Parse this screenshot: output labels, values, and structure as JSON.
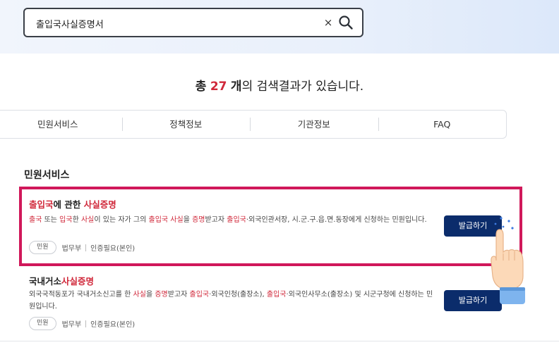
{
  "search": {
    "value": "출입국사실증명서",
    "clear_label": "×"
  },
  "summary": {
    "prefix": "총",
    "count": "27",
    "unit": "개",
    "suffix": "의 검색결과가 있습니다."
  },
  "tabs": [
    {
      "label": "민원서비스"
    },
    {
      "label": "정책정보"
    },
    {
      "label": "기관정보"
    },
    {
      "label": "FAQ"
    }
  ],
  "section": {
    "title": "민원서비스"
  },
  "results": [
    {
      "title_hl_1": "출입국",
      "title_mid": "에 관한 ",
      "title_hl_2": "사실증명",
      "desc": {
        "p1": "출국",
        "p2": " 또는 ",
        "p3": "입국",
        "p4": "한 ",
        "p5": "사실",
        "p6": "이 있는 자가 그의 ",
        "p7": "출입국 사실",
        "p8": "을 ",
        "p9": "증명",
        "p10": "받고자 ",
        "p11": "출입국",
        "p12": "·외국인관서장, 시.군.구.읍.면.동장에게 신청하는 민원입니다."
      },
      "pill": "민원",
      "org": "법무부",
      "auth": "인증필요(본인)",
      "button": "발급하기"
    },
    {
      "title_plain": "국내거소",
      "title_hl": "사실증명",
      "desc": {
        "p1": "외국국적동포가 국내거소신고를 한 ",
        "p2": "사실",
        "p3": "을 ",
        "p4": "증명",
        "p5": "받고자 ",
        "p6": "출입국",
        "p7": "·외국인청(출장소), ",
        "p8": "출입국",
        "p9": "·외국인사무소(출장소) 및 시군구청에 신청하는 민원입니다."
      },
      "pill": "민원",
      "org": "법무부",
      "auth": "인증필요(본인)",
      "button": "발급하기"
    }
  ],
  "colors": {
    "accent_red": "#d0283a",
    "highlight_frame": "#d0185a",
    "button_navy": "#0b2c6b"
  },
  "icons": [
    "search-icon",
    "close-icon",
    "pointing-hand-icon"
  ]
}
